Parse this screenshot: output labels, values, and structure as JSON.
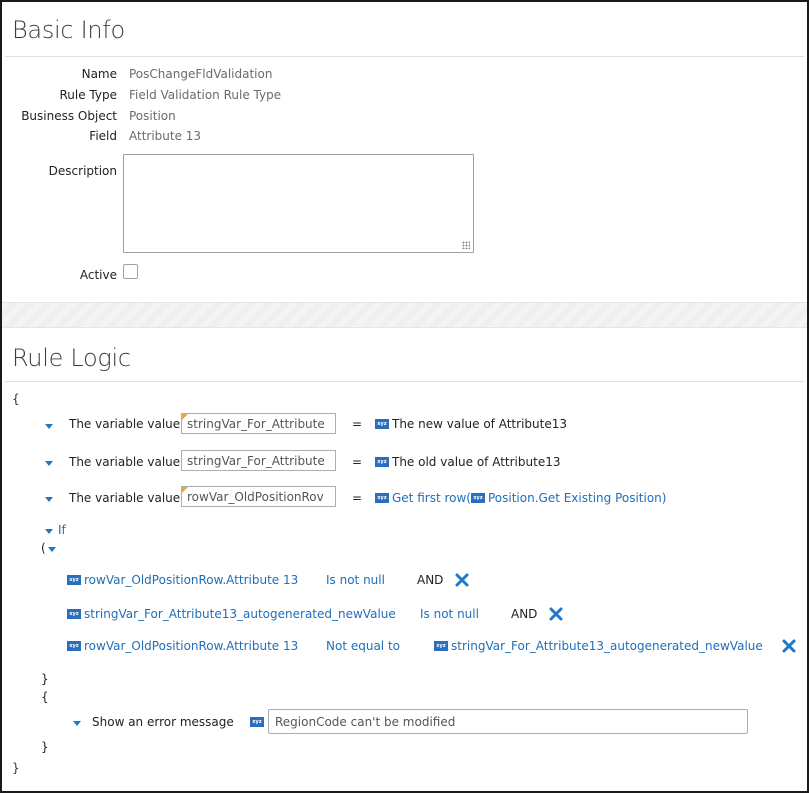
{
  "basic_info": {
    "title": "Basic Info",
    "fields": [
      {
        "label": "Name",
        "value": "PosChangeFldValidation"
      },
      {
        "label": "Rule Type",
        "value": "Field Validation Rule Type"
      },
      {
        "label": "Business Object",
        "value": "Position"
      },
      {
        "label": "Field",
        "value": "Attribute 13"
      }
    ],
    "description_label": "Description",
    "description_value": "",
    "active_label": "Active",
    "active_checked": false
  },
  "rule_logic": {
    "title": "Rule Logic",
    "open_brace": "{",
    "close_brace": "}",
    "assign_label": "The variable value",
    "equals": "=",
    "xyz_glyph": "xyz",
    "assignments": [
      {
        "var": "stringVar_For_Attribute",
        "rhs": "The new value of Attribute13"
      },
      {
        "var": "stringVar_For_Attribute",
        "rhs": "The old value of Attribute13"
      },
      {
        "var": "rowVar_OldPositionRov",
        "rhs_prefix": "Get first row(",
        "rhs_inner": "Position.Get Existing Position",
        "rhs_suffix": ")"
      }
    ],
    "if_label": "If",
    "paren_open": "(",
    "conditions": [
      {
        "left": "rowVar_OldPositionRow.Attribute 13",
        "op": "Is not null",
        "join": "AND"
      },
      {
        "left": "stringVar_For_Attribute13_autogenerated_newValue",
        "op": "Is not null",
        "join": "AND"
      },
      {
        "left": "rowVar_OldPositionRow.Attribute 13",
        "op": "Not equal to",
        "right": "stringVar_For_Attribute13_autogenerated_newValue"
      }
    ],
    "inner_close": "}",
    "inner_open": "{",
    "action_label": "Show an error message",
    "error_message": "RegionCode can't be modified",
    "inner_close2": "}"
  },
  "colors": {
    "accent": "#1f6fb8",
    "delete": "#1f78c8",
    "flag": "#f0a050"
  }
}
